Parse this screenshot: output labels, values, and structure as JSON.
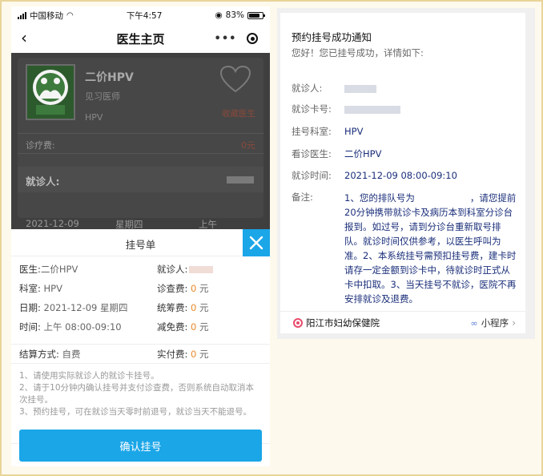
{
  "status_bar": {
    "carrier": "中国移动",
    "time": "下午4:57",
    "battery": "83%",
    "battery_level": 0.83
  },
  "nav": {
    "title": "医生主页",
    "more_icon": "ellipsis-icon",
    "close_icon": "target-icon"
  },
  "doctor": {
    "name": "二价HPV",
    "title": "见习医师",
    "dept": "HPV",
    "favorite_label": "收藏医生",
    "fee_label": "诊疗费:",
    "fee_value": "0元",
    "patient_label": "就诊人:"
  },
  "date_strip": {
    "date": "2021-12-09",
    "weekday": "星期四",
    "period": "上午"
  },
  "sheet": {
    "title": "挂号单",
    "rows": [
      {
        "label": "医生:",
        "value": "二价HPV"
      },
      {
        "label": "就诊人:",
        "value": ""
      },
      {
        "label": "科室:",
        "value": "HPV"
      },
      {
        "label": "诊查费:",
        "value": "0",
        "unit": "元"
      },
      {
        "label": "日期:",
        "value": "2021-12-09 星期四"
      },
      {
        "label": "统筹费:",
        "value": "0",
        "unit": "元"
      },
      {
        "label": "时间:",
        "value": "上午 08:00-09:10"
      },
      {
        "label": "减免费:",
        "value": "0",
        "unit": "元"
      },
      {
        "label": "结算方式:",
        "value": "自费"
      },
      {
        "label": "实付费:",
        "value": "0",
        "unit": "元"
      }
    ],
    "notes": [
      "1、请使用实际就诊人的就诊卡挂号。",
      "2、请于10分钟内确认挂号并支付诊查费，否则系统自动取消本次挂号。",
      "3、预约挂号，可在就诊当天零时前退号，就诊当天不能退号。"
    ],
    "confirm_label": "确认挂号"
  },
  "message": {
    "title": "预约挂号成功通知",
    "greeting": "您好！您已挂号成功，详情如下:",
    "fields": [
      {
        "label": "就诊人:",
        "value": ""
      },
      {
        "label": "就诊卡号:",
        "value": ""
      },
      {
        "label": "挂号科室:",
        "value": "HPV"
      },
      {
        "label": "看诊医生:",
        "value": "二价HPV"
      },
      {
        "label": "就诊时间:",
        "value": "2021-12-09 08:00-09:10"
      }
    ],
    "remark_label": "备注:",
    "remark_text": "1、您的排队号为　　　　　　，请您提前20分钟携带就诊卡及病历本到科室分诊台报到。如过号，请到分诊台重新取号排队。就诊时间仅供参考，以医生呼叫为准。2、本系统挂号需预扣挂号费，建卡时请存一定金额到诊卡中，待就诊时正式从卡中扣取。3、当天挂号不就诊，医院不再安排就诊及退费。",
    "hospital": "阳江市妇幼保健院",
    "miniprogram_label": "小程序"
  }
}
